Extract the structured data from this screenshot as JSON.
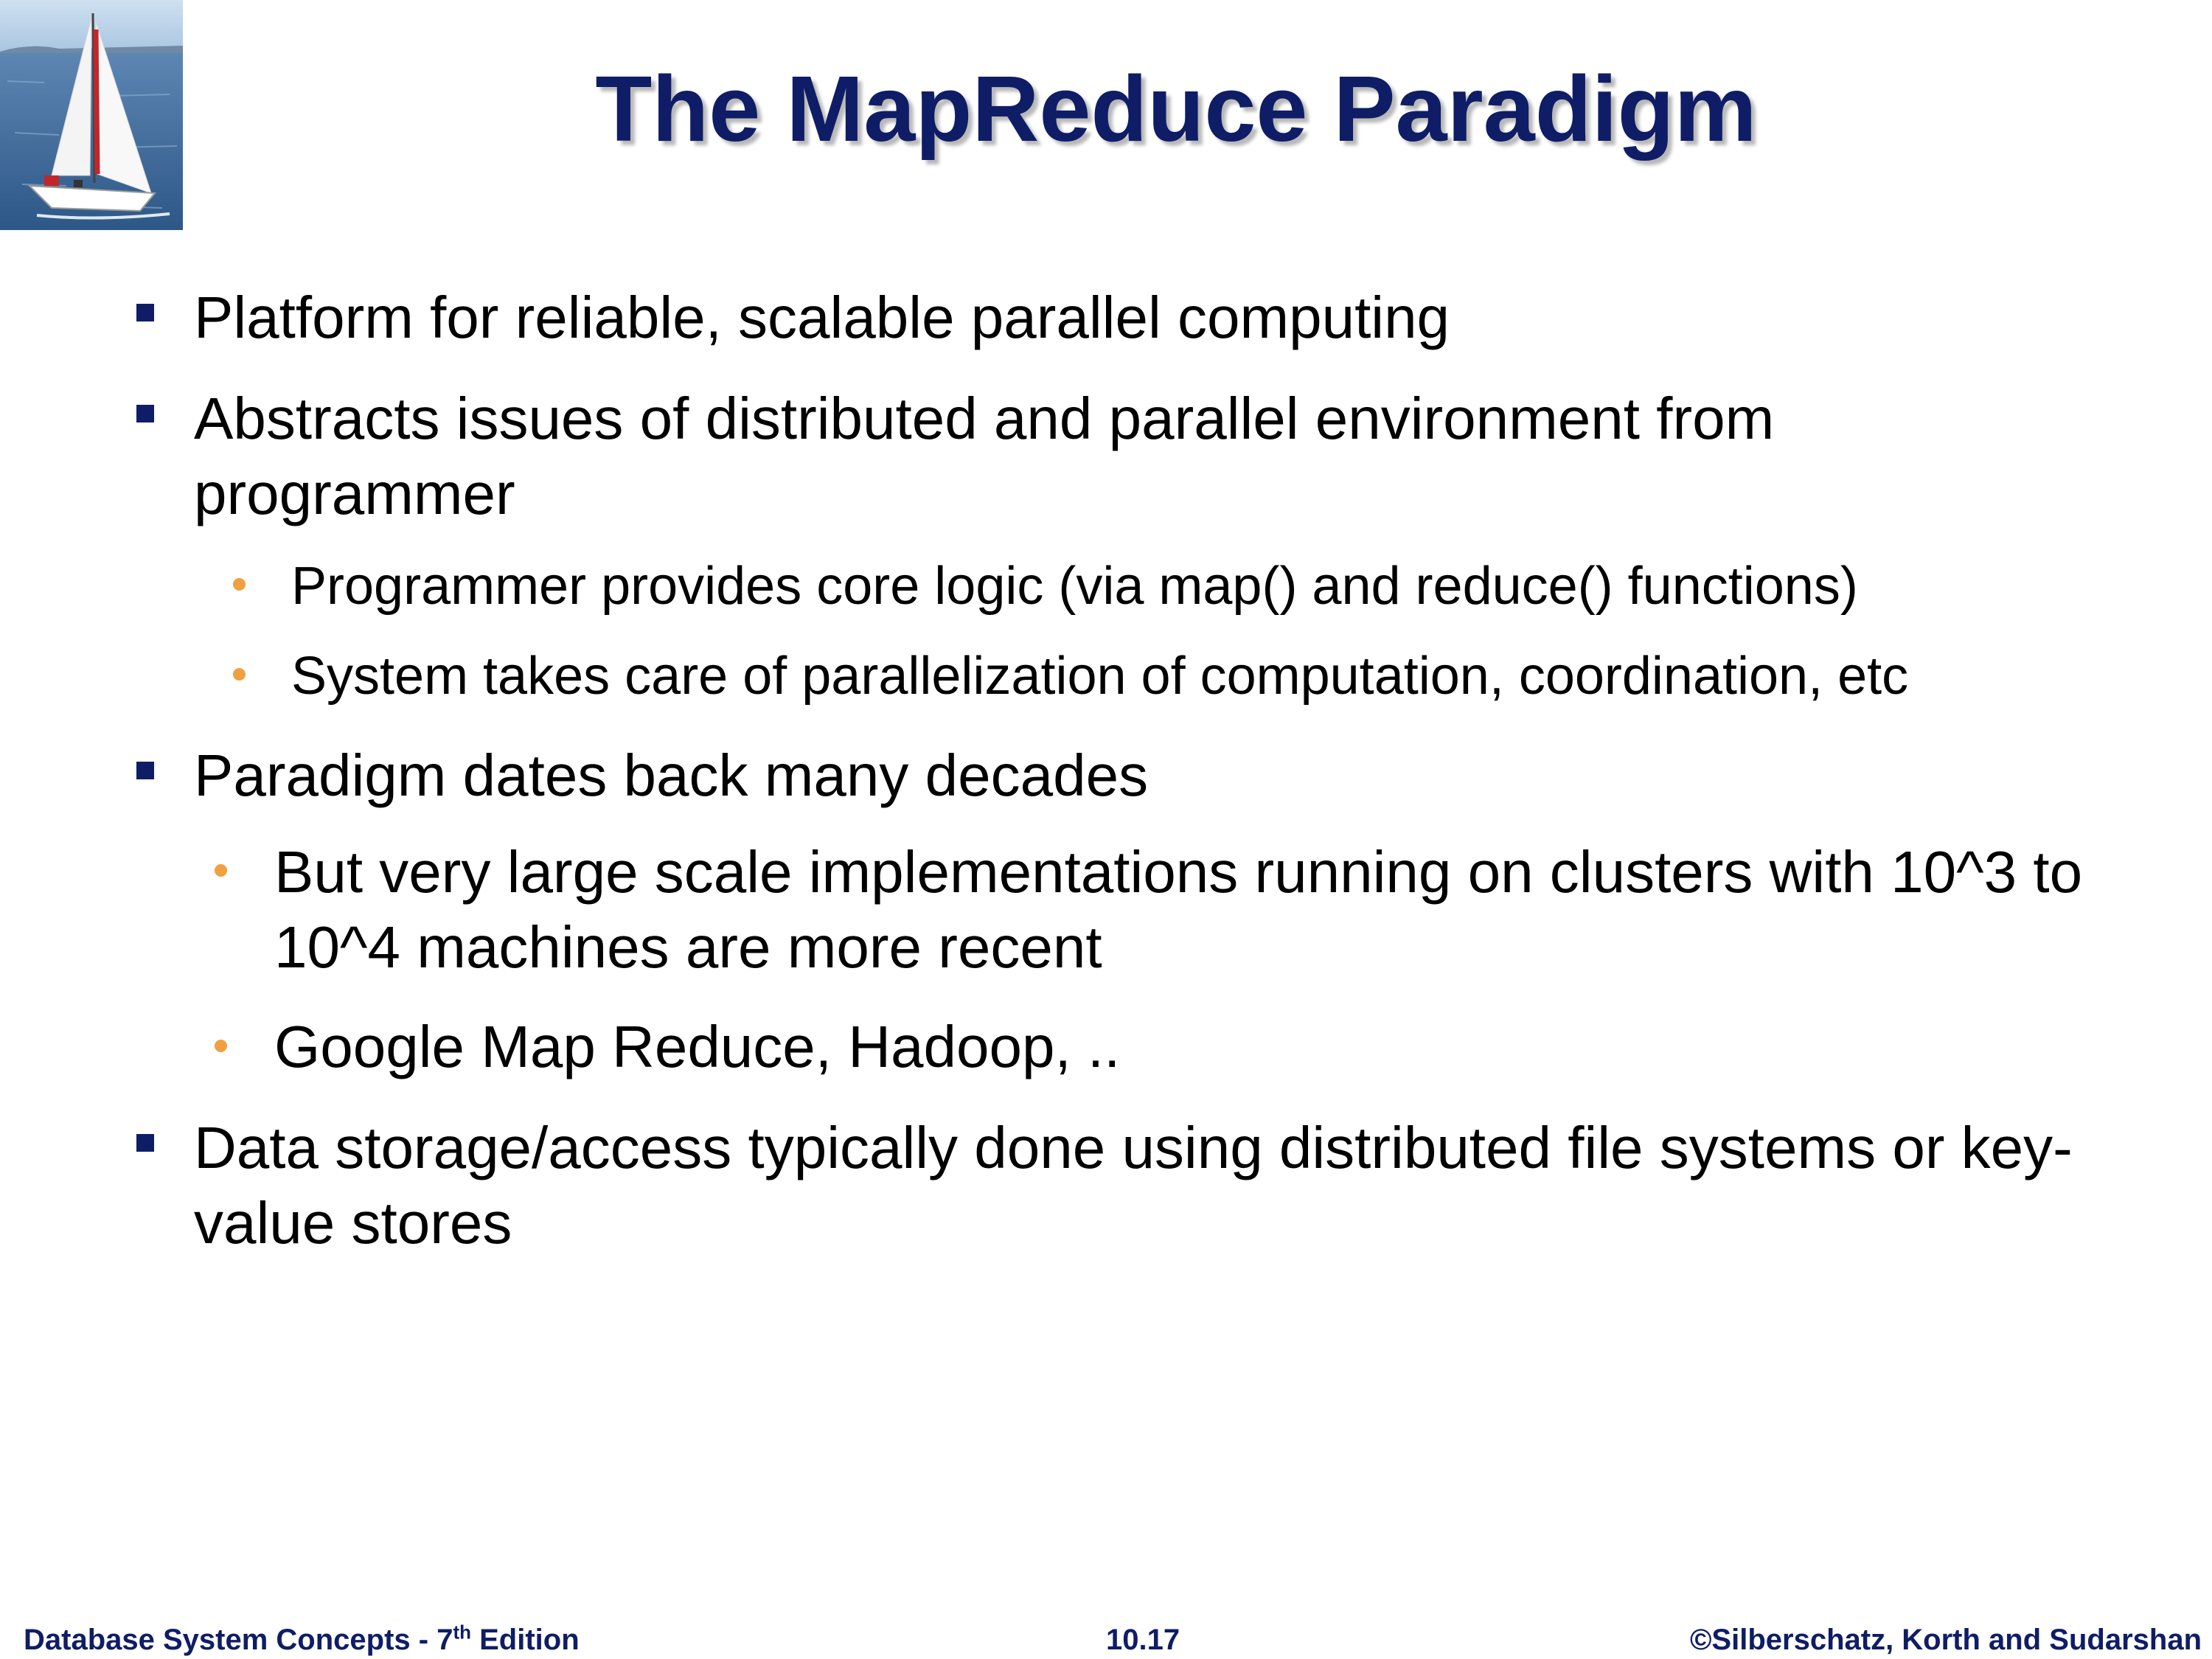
{
  "slide": {
    "title": "The MapReduce Paradigm",
    "bullets": [
      "Platform for reliable, scalable parallel computing",
      "Abstracts issues of distributed and parallel environment from programmer",
      "Programmer provides core logic (via map() and reduce() functions)",
      "System takes care of parallelization of computation, coordination, etc",
      "Paradigm dates back many decades",
      "But very large scale implementations running on clusters with 10^3 to 10^4 machines are more recent",
      "Google Map Reduce, Hadoop, ..",
      "Data storage/access typically done using distributed file systems or key-value stores"
    ]
  },
  "footer": {
    "book_prefix": "Database System Concepts - 7",
    "book_sup": "th",
    "book_suffix": " Edition",
    "page_number": "10.17",
    "copyright": "©Silberschatz, Korth and Sudarshan"
  },
  "colors": {
    "title": "#0f1d66",
    "level1_bullet": "#0f1d66",
    "level2_bullet": "#f0a040",
    "footer": "#0f1d66"
  },
  "icons": {
    "logo": "sailboat-logo",
    "level1_bullet": "square-bullet-icon",
    "level2_bullet": "round-bullet-icon"
  }
}
